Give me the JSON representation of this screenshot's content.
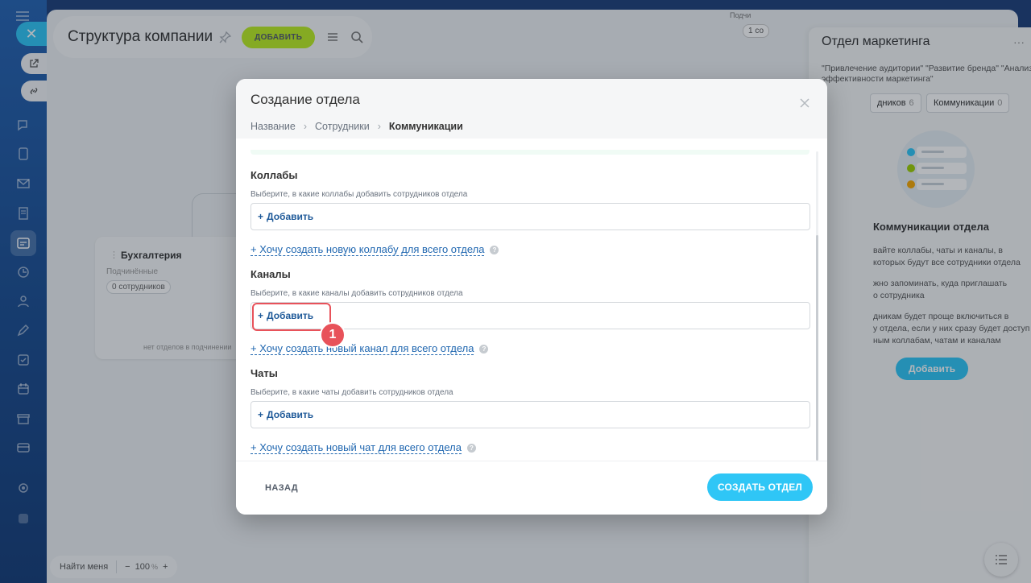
{
  "page": {
    "title": "Структура компании",
    "add_button": "ДОБАВИТЬ"
  },
  "org_card": {
    "title": "Бухгалтерия",
    "subtitle": "Подчинённые",
    "badge": "0 сотрудников",
    "footer": "нет отделов в подчинении"
  },
  "zoom": {
    "find_me": "Найти меня",
    "minus": "−",
    "value": "100",
    "unit": "%",
    "plus": "+"
  },
  "top_right": {
    "label": "Подчи",
    "badge": "1 со"
  },
  "side_panel": {
    "title": "Отдел маркетинга",
    "description": "\"Привлечение аудитории\" \"Развитие бренда\" \"Анализ эффективности маркетинга\"",
    "tabs": [
      {
        "label": "дников",
        "count": "6"
      },
      {
        "label": "Коммуникации",
        "count": "0"
      }
    ],
    "heading": "Коммуникации отдела",
    "paragraphs": [
      "вайте коллабы, чаты и каналы, в\nкоторых будут все сотрудники отдела",
      "жно запоминать, куда приглашать\nо сотрудника",
      "дникам будет проще включиться в\nу отдела, если у них сразу будет доступ\nным коллабам, чатам и каналам"
    ],
    "add_button": "Добавить"
  },
  "modal": {
    "title": "Создание отдела",
    "steps": [
      "Название",
      "Сотрудники",
      "Коммуникации"
    ],
    "sections": [
      {
        "title": "Коллабы",
        "description": "Выберите, в какие коллабы добавить сотрудников отдела",
        "add_label": "Добавить",
        "create_link": "Хочу создать новую коллабу для всего отдела"
      },
      {
        "title": "Каналы",
        "description": "Выберите, в какие каналы добавить сотрудников отдела",
        "add_label": "Добавить",
        "create_link": "Хочу создать новый канал для всего отдела"
      },
      {
        "title": "Чаты",
        "description": "Выберите, в какие чаты добавить сотрудников отдела",
        "add_label": "Добавить",
        "create_link": "Хочу создать новый чат для всего отдела"
      }
    ],
    "back_button": "НАЗАД",
    "create_button": "СОЗДАТЬ ОТДЕЛ",
    "step_marker": "1"
  },
  "colors": {
    "accent": "#2fc6f6",
    "green": "#bbed21",
    "marker": "#e8525a",
    "link": "#2067b0"
  }
}
